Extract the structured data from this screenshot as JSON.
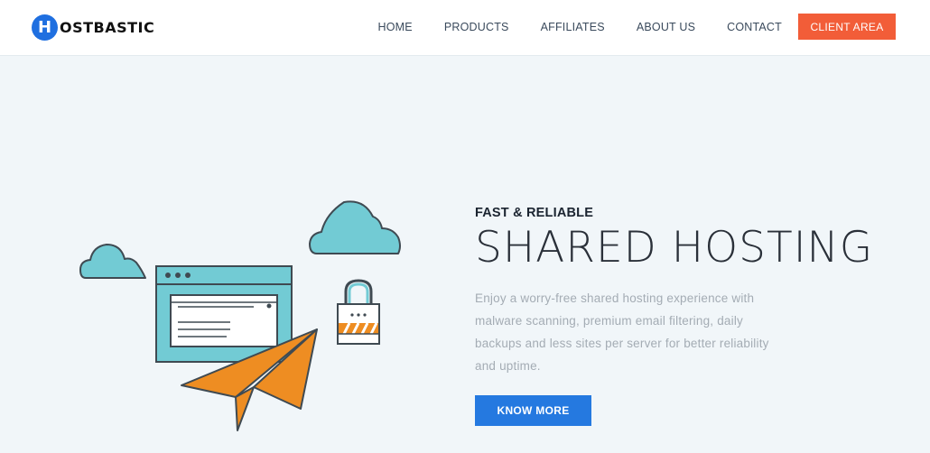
{
  "brand": {
    "mark": "H",
    "name": "OSTBASTIC"
  },
  "nav": {
    "items": [
      "HOME",
      "PRODUCTS",
      "AFFILIATES",
      "ABOUT US",
      "CONTACT"
    ],
    "cta": "CLIENT AREA"
  },
  "hero": {
    "eyebrow": "FAST & RELIABLE",
    "title": "SHARED HOSTING",
    "description": "Enjoy a worry-free shared hosting experience with malware scanning, premium email filtering, daily backups and less sites per server for better reliability and uptime.",
    "button": "KNOW MORE"
  },
  "illustration": {
    "icons": [
      "cloud-icon",
      "browser-window-icon",
      "padlock-icon",
      "paper-plane-icon"
    ]
  },
  "colors": {
    "brand_blue": "#1f6fe0",
    "client_area_orange": "#f25d38",
    "cta_blue": "#2579e0",
    "illustration_teal": "#72cbd4",
    "illustration_orange": "#ee8d22",
    "background": "#f1f6f9"
  }
}
